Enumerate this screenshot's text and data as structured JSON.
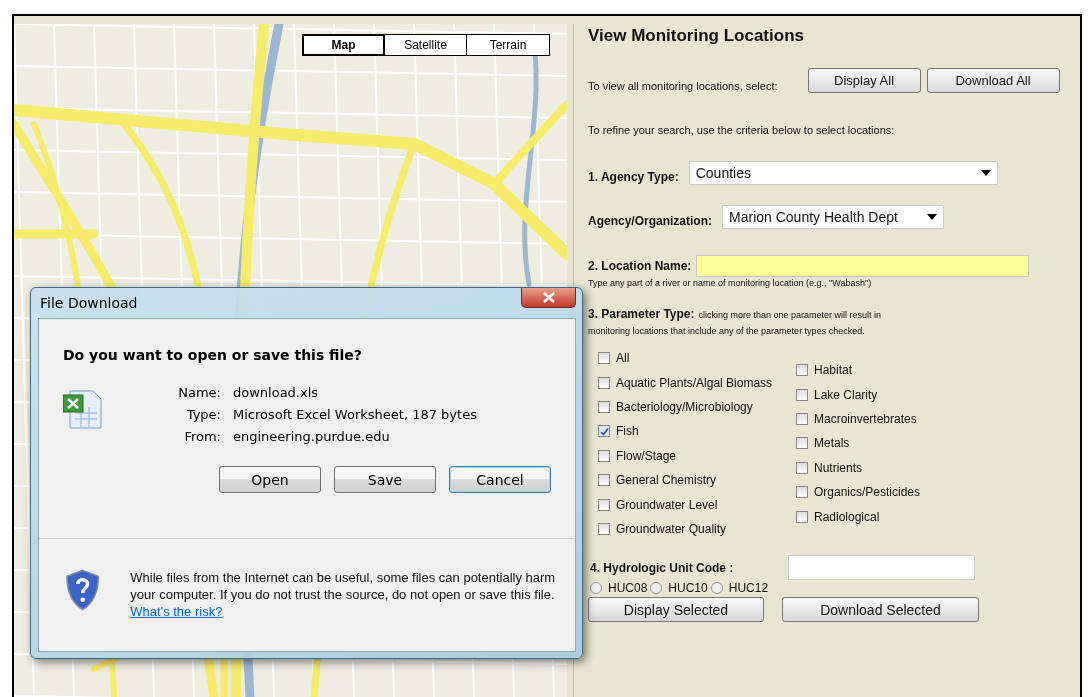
{
  "map": {
    "map_types": [
      {
        "label": "Map",
        "selected": true
      },
      {
        "label": "Satellite",
        "selected": false
      },
      {
        "label": "Terrain",
        "selected": false
      }
    ]
  },
  "panel": {
    "title": "View Monitoring Locations",
    "view_all_prompt": "To view all monitoring locations, select:",
    "view_all_buttons": [
      "Display All",
      "Download All"
    ],
    "refine_prompt": "To refine your search, use the criteria below to select locations:",
    "agency_type": {
      "label": "1. Agency Type:",
      "value": "Counties"
    },
    "agency_org": {
      "label": "Agency/Organization:",
      "value": "Marion County Health Dept"
    },
    "location_name": {
      "label": "2. Location Name:",
      "hint": "Type any part of a river or name of monitoring location (e.g., \"Wabash\")"
    },
    "parameter_type": {
      "label": "3. Parameter Type:",
      "note": "clicking more than one parameter will result in monitoring locations that include any of the parameter types checked."
    },
    "parameters_left": [
      {
        "label": "All",
        "checked": false
      },
      {
        "label": "Aquatic Plants/Algal Biomass",
        "checked": false
      },
      {
        "label": "Bacteriology/Microbiology",
        "checked": false
      },
      {
        "label": "Fish",
        "checked": true
      },
      {
        "label": "Flow/Stage",
        "checked": false
      },
      {
        "label": "General Chemistry",
        "checked": false
      },
      {
        "label": "Groundwater Level",
        "checked": false
      },
      {
        "label": "Groundwater Quality",
        "checked": false
      }
    ],
    "parameters_right": [
      {
        "label": "Habitat",
        "checked": false
      },
      {
        "label": "Lake Clarity",
        "checked": false
      },
      {
        "label": "Macroinvertebrates",
        "checked": false
      },
      {
        "label": "Metals",
        "checked": false
      },
      {
        "label": "Nutrients",
        "checked": false
      },
      {
        "label": "Organics/Pesticides",
        "checked": false
      },
      {
        "label": "Radiological",
        "checked": false
      }
    ],
    "huc": {
      "label": "4. Hydrologic Unit Code :",
      "options": [
        {
          "label": "HUC08",
          "selected": false
        },
        {
          "label": "HUC10",
          "selected": false
        },
        {
          "label": "HUC12",
          "selected": false
        }
      ]
    },
    "action_buttons": [
      "Display Selected",
      "Download Selected"
    ]
  },
  "dialog": {
    "title": "File Download",
    "question": "Do you want to open or save this file?",
    "fields": [
      {
        "label": "Name:",
        "value": "download.xls"
      },
      {
        "label": "Type:",
        "value": "Microsoft Excel Worksheet, 187 bytes"
      },
      {
        "label": "From:",
        "value": "engineering.purdue.edu"
      }
    ],
    "buttons": [
      {
        "label": "Open",
        "default": false
      },
      {
        "label": "Save",
        "default": false
      },
      {
        "label": "Cancel",
        "default": true
      }
    ],
    "warning": "While files from the Internet can be useful, some files can potentially harm your computer. If you do not trust the source, do not open or save this file.",
    "risk_link": "What's the risk?"
  }
}
